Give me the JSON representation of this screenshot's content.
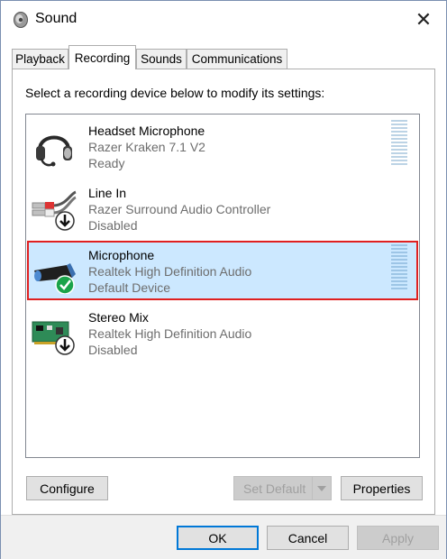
{
  "window": {
    "title": "Sound",
    "close_symbol": "✕",
    "title_icon": "speaker-icon",
    "close_icon": "close-icon"
  },
  "tabs": [
    {
      "label": "Playback",
      "active": false
    },
    {
      "label": "Recording",
      "active": true
    },
    {
      "label": "Sounds",
      "active": false
    },
    {
      "label": "Communications",
      "active": false
    }
  ],
  "panel": {
    "instruction": "Select a recording device below to modify its settings:"
  },
  "devices": [
    {
      "name": "Headset Microphone",
      "driver": "Razer Kraken 7.1 V2",
      "status": "Ready",
      "icon": "headset-icon",
      "selected": false
    },
    {
      "name": "Line In",
      "driver": "Razer Surround Audio Controller",
      "status": "Disabled",
      "icon": "line-in-cable-icon",
      "selected": false
    },
    {
      "name": "Microphone",
      "driver": "Realtek High Definition Audio",
      "status": "Default Device",
      "icon": "microphone-icon",
      "selected": true
    },
    {
      "name": "Stereo Mix",
      "driver": "Realtek High Definition Audio",
      "status": "Disabled",
      "icon": "sound-card-icon",
      "selected": false
    }
  ],
  "buttons": {
    "configure": "Configure",
    "set_default": "Set Default",
    "properties": "Properties",
    "ok": "OK",
    "cancel": "Cancel",
    "apply": "Apply"
  },
  "colors": {
    "selection_bg": "#cce8ff",
    "highlight_outline": "#e02020",
    "default_button_border": "#0078d7",
    "default_check": "#16a34a"
  }
}
